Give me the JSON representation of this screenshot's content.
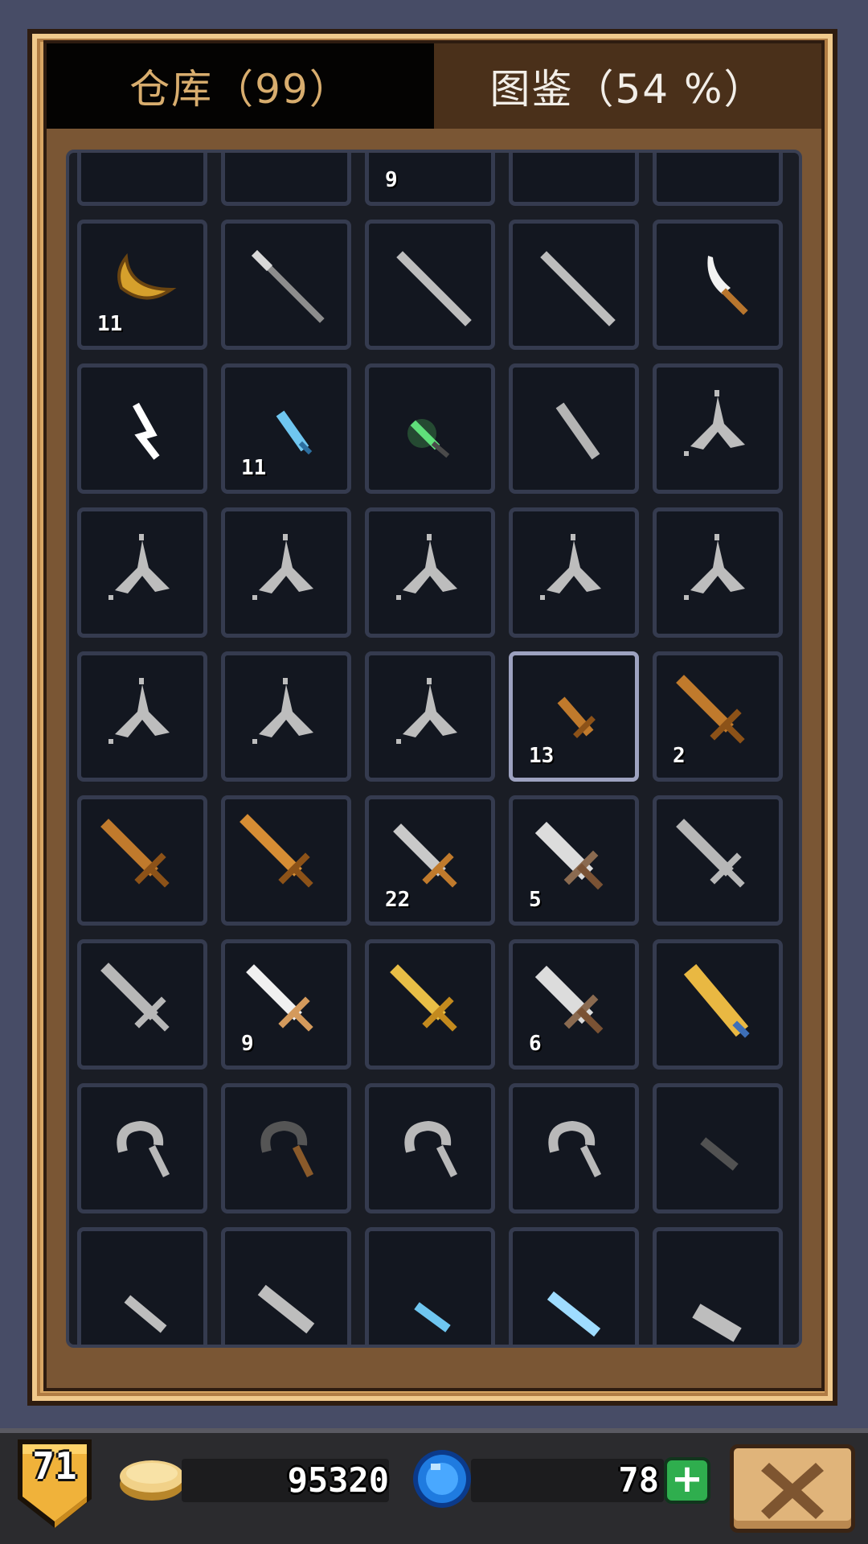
{
  "tabs": {
    "storage_label": "仓库（99）",
    "collection_label": "图鉴（54 %）"
  },
  "grid": {
    "selected_index": 23,
    "items": [
      {
        "icon": "gray-bow-icon",
        "count": ""
      },
      {
        "icon": "silver-bow-icon",
        "count": ""
      },
      {
        "icon": "golden-bow-icon",
        "count": "9"
      },
      {
        "icon": "silver-bow-icon",
        "count": ""
      },
      {
        "icon": "silver-bow-icon",
        "count": ""
      },
      {
        "icon": "golden-boomerang-icon",
        "count": "11"
      },
      {
        "icon": "iron-spear-icon",
        "count": ""
      },
      {
        "icon": "staff-icon",
        "count": ""
      },
      {
        "icon": "staff-icon",
        "count": ""
      },
      {
        "icon": "curved-dagger-icon",
        "count": ""
      },
      {
        "icon": "white-zigzag-blade-icon",
        "count": ""
      },
      {
        "icon": "ice-dagger-icon",
        "count": "11"
      },
      {
        "icon": "emerald-dagger-icon",
        "count": ""
      },
      {
        "icon": "gray-dagger-icon",
        "count": ""
      },
      {
        "icon": "caltrop-icon",
        "count": ""
      },
      {
        "icon": "caltrop-icon",
        "count": ""
      },
      {
        "icon": "caltrop-icon",
        "count": ""
      },
      {
        "icon": "caltrop-icon",
        "count": ""
      },
      {
        "icon": "caltrop-icon",
        "count": ""
      },
      {
        "icon": "caltrop-icon",
        "count": ""
      },
      {
        "icon": "caltrop-icon",
        "count": ""
      },
      {
        "icon": "caltrop-icon",
        "count": ""
      },
      {
        "icon": "caltrop-icon",
        "count": ""
      },
      {
        "icon": "wooden-dagger-icon",
        "count": "13"
      },
      {
        "icon": "wooden-sword-icon",
        "count": "2"
      },
      {
        "icon": "wooden-sword-icon",
        "count": ""
      },
      {
        "icon": "wooden-greatsword-icon",
        "count": ""
      },
      {
        "icon": "iron-short-sword-icon",
        "count": "22"
      },
      {
        "icon": "steel-broadsword-icon",
        "count": "5"
      },
      {
        "icon": "gray-sword-icon",
        "count": ""
      },
      {
        "icon": "gray-sword-icon",
        "count": ""
      },
      {
        "icon": "silver-sword-icon",
        "count": "9"
      },
      {
        "icon": "golden-short-sword-icon",
        "count": ""
      },
      {
        "icon": "steel-broadsword-icon",
        "count": "6"
      },
      {
        "icon": "golden-greatsword-icon",
        "count": ""
      },
      {
        "icon": "gray-sickle-icon",
        "count": ""
      },
      {
        "icon": "dark-sickle-icon",
        "count": ""
      },
      {
        "icon": "gray-sickle-icon",
        "count": ""
      },
      {
        "icon": "gray-sickle-icon",
        "count": ""
      },
      {
        "icon": "dark-dagger-icon",
        "count": ""
      },
      {
        "icon": "gray-blade-icon",
        "count": ""
      },
      {
        "icon": "gray-machete-icon",
        "count": ""
      },
      {
        "icon": "ice-blade-icon",
        "count": ""
      },
      {
        "icon": "ice-sword-icon",
        "count": ""
      },
      {
        "icon": "gray-cleaver-icon",
        "count": ""
      }
    ]
  },
  "status": {
    "level": "71",
    "gold": "95320",
    "gems": "78"
  },
  "colors": {
    "gold": "#e8b448",
    "wood": "#b8762e",
    "silver": "#d4d4d4",
    "gray": "#a9a9a9",
    "dark": "#4b4b4b",
    "ice": "#6fc6f0",
    "emerald": "#5fe07a",
    "frame": "#d8a664",
    "cell_bg": "#131720"
  }
}
